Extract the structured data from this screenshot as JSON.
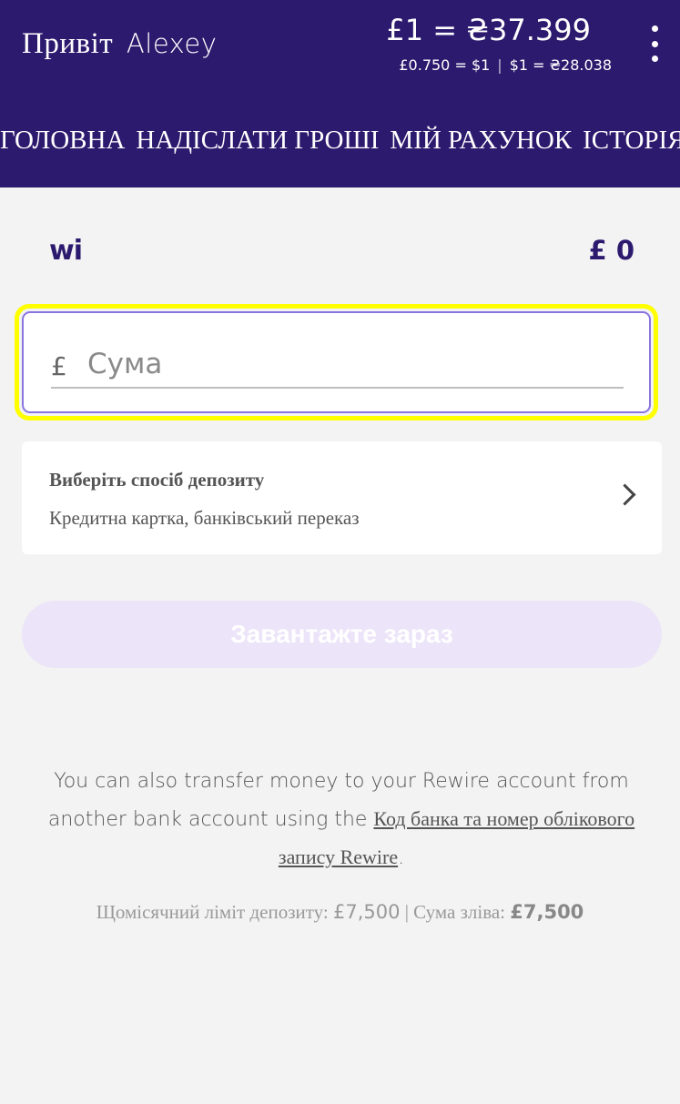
{
  "header": {
    "greeting": "Привіт",
    "user_name": "Alexey",
    "rate_main": "£1 = ₴37.399",
    "rate_gbp_usd": "£0.750 = $1",
    "rate_sep": "|",
    "rate_usd_uah": "$1 = ₴28.038",
    "menu_icon": "kebab-menu-icon"
  },
  "nav": {
    "items": [
      "ГОЛОВНА",
      "НАДІСЛАТИ ГРОШІ",
      "МІЙ РАХУНОК",
      "ІСТОРІЯ"
    ]
  },
  "wallet": {
    "logo_text": "wi",
    "balance": "£ 0"
  },
  "amount": {
    "currency": "£",
    "placeholder": "Сума",
    "value": ""
  },
  "deposit_method": {
    "title": "Виберіть спосіб депозиту",
    "subtitle": "Кредитна картка, банківський переказ"
  },
  "load_button": "Завантажте зараз",
  "info": {
    "text_before": "You can also transfer money to your Rewire account from another bank account using the ",
    "link_text": "Код банка та номер облікового запису Rewire",
    "text_after": "."
  },
  "limits": {
    "monthly_label": "Щомісячний ліміт депозиту:",
    "monthly_value": "£7,500",
    "separator": "|",
    "remaining_label": "Сума зліва:",
    "remaining_value": "£7,500"
  },
  "colors": {
    "header_bg": "#2c1a6e",
    "highlight": "#ffff00",
    "input_border": "#8a75e0",
    "button_disabled": "#ece4f8"
  }
}
